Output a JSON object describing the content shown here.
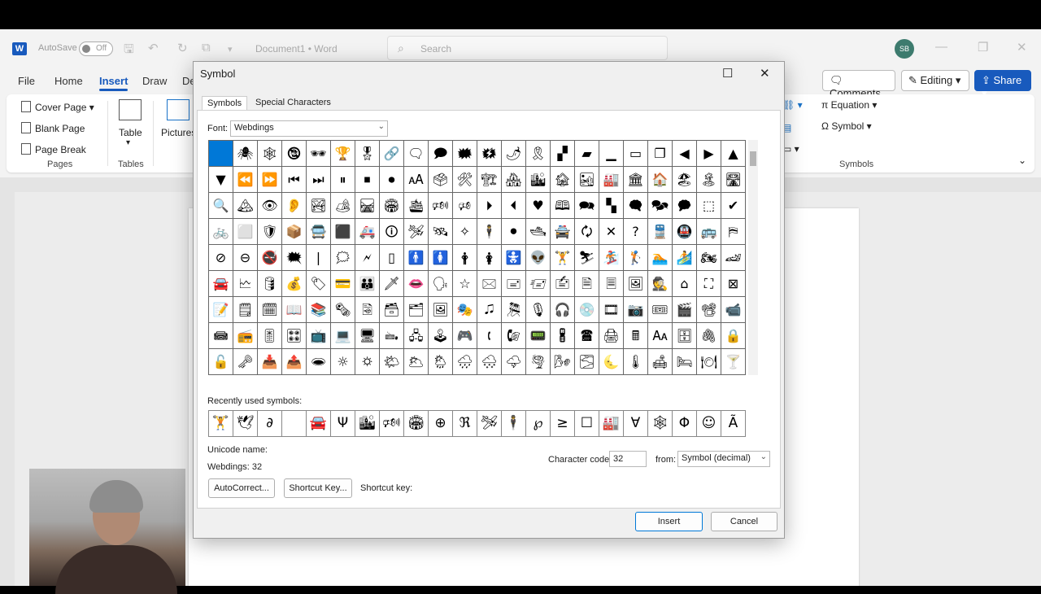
{
  "titlebar": {
    "app_icon": "word-icon",
    "autosave_label": "AutoSave",
    "autosave_state": "Off",
    "doc_title": "Document1 • Word",
    "search_placeholder": "Search",
    "user_initials": "SB"
  },
  "ribbon_tabs": [
    "File",
    "Home",
    "Insert",
    "Draw",
    "De"
  ],
  "ribbon_right": {
    "comments": "Comments",
    "editing": "Editing",
    "share": "Share"
  },
  "ribbon": {
    "pages": {
      "cover_page": "Cover Page",
      "blank_page": "Blank Page",
      "page_break": "Page Break",
      "label": "Pages"
    },
    "tables": {
      "table": "Table",
      "label": "Tables"
    },
    "illustrations": {
      "pictures": "Pictures"
    },
    "symbols": {
      "equation": "Equation",
      "symbol": "Symbol",
      "label": "Symbols"
    }
  },
  "dialog": {
    "title": "Symbol",
    "tabs": [
      "Symbols",
      "Special Characters"
    ],
    "font_label": "Font:",
    "font_value": "Webdings",
    "symbol_grid": [
      [
        "",
        "🕷",
        "🕸",
        "🕲",
        "🕶",
        "🏆",
        "🎖",
        "🔗",
        "🗨",
        "🗩",
        "🗰",
        "🗱",
        "🌶",
        "🎗",
        "▞",
        "▰",
        "▁",
        "▭",
        "❐",
        "◀",
        "▶",
        "▲"
      ],
      [
        "▼",
        "⏪",
        "⏩",
        "⏮",
        "⏭",
        "⏸",
        "⏹",
        "⏺",
        "🗚",
        "🗳",
        "🛠",
        "🏗",
        "🏘",
        "🏙",
        "🏚",
        "🏜",
        "🏭",
        "🏛",
        "🏠",
        "🏖",
        "🏝",
        "🛣"
      ],
      [
        "🔍",
        "🏔",
        "👁",
        "👂",
        "🏞",
        "🏕",
        "🛤",
        "🏟",
        "🛳",
        "🕬",
        "🕫",
        "⏵",
        "⏴",
        "♥",
        "🕮",
        "🗪",
        "▚",
        "🗬",
        "🗫",
        "🗭",
        "⬚",
        "✔"
      ],
      [
        "🚲",
        "⬜",
        "🛡",
        "📦",
        "🚍",
        "⬛",
        "🚑",
        "🛈",
        "🛩",
        "🛰",
        "✧",
        "🕴",
        "⚫",
        "🛥",
        "🚔",
        "🗘",
        "✕",
        "?",
        "🚆",
        "🚇",
        "🚌",
        "⛿"
      ],
      [
        "⊘",
        "⊖",
        "🚭",
        "🗮",
        "|",
        "🗯",
        "🗲",
        "▯",
        "🚹",
        "🚺",
        "🛉",
        "🛊",
        "🚼",
        "👽",
        "🏋",
        "⛷",
        "🏂",
        "🏌",
        "🏊",
        "🏄",
        "🏍",
        "🏎"
      ],
      [
        "🚘",
        "🗠",
        "🛢",
        "💰",
        "🏷",
        "💳",
        "👪",
        "🗡",
        "👄",
        "🗣",
        "☆",
        "🖂",
        "🖃",
        "🖅",
        "🖆",
        "🗎",
        "🗏",
        "🖼",
        "🕵",
        "⌂",
        "⛶",
        "⊠"
      ],
      [
        "📝",
        "🗒",
        "🗓",
        "📖",
        "📚",
        "🗞",
        "🗟",
        "🗃",
        "🗂",
        "🖼",
        "🎭",
        "🎜",
        "🎘",
        "🎙",
        "🎧",
        "💿",
        "🎞",
        "📷",
        "🎟",
        "🎬",
        "📽",
        "📹"
      ],
      [
        "📾",
        "📻",
        "🎚",
        "🎛",
        "📺",
        "💻",
        "🖥",
        "🖦",
        "🖧",
        "🕹",
        "🎮",
        "🕻",
        "🕼",
        "📟",
        "🖁",
        "🖀",
        "🖨",
        "🖩",
        "🗛",
        "🗄",
        "🖇",
        "🔒"
      ],
      [
        "🔓",
        "🗝",
        "📥",
        "📤",
        "🕳",
        "☼",
        "🌣",
        "🌤",
        "🌥",
        "🌦",
        "🌧",
        "🌨",
        "🌩",
        "🌪",
        "🌬",
        "🌫",
        "🌜",
        "🌡",
        "🛋",
        "🛏",
        "🍽",
        "🍸"
      ]
    ],
    "recent_label": "Recently used symbols:",
    "recent_symbols": [
      "🏋",
      "🕊",
      "∂",
      "",
      "🚘",
      "Ψ",
      "🏙",
      "🕬",
      "🏟",
      "⊕",
      "ℜ",
      "🛩",
      "🕴",
      "℘",
      "≥",
      "☐",
      "🏭",
      "∀",
      "🕸",
      "Φ",
      "☺",
      "Ã"
    ],
    "unicode_name_label": "Unicode name:",
    "unicode_name_value": "Webdings: 32",
    "char_code_label": "Character code:",
    "char_code_value": "32",
    "from_label": "from:",
    "from_value": "Symbol (decimal)",
    "autocorrect": "AutoCorrect...",
    "shortcut_key_btn": "Shortcut Key...",
    "shortcut_key_label": "Shortcut key:",
    "insert": "Insert",
    "cancel": "Cancel"
  },
  "colors": {
    "accent": "#185abd",
    "selection": "#0078d7"
  }
}
